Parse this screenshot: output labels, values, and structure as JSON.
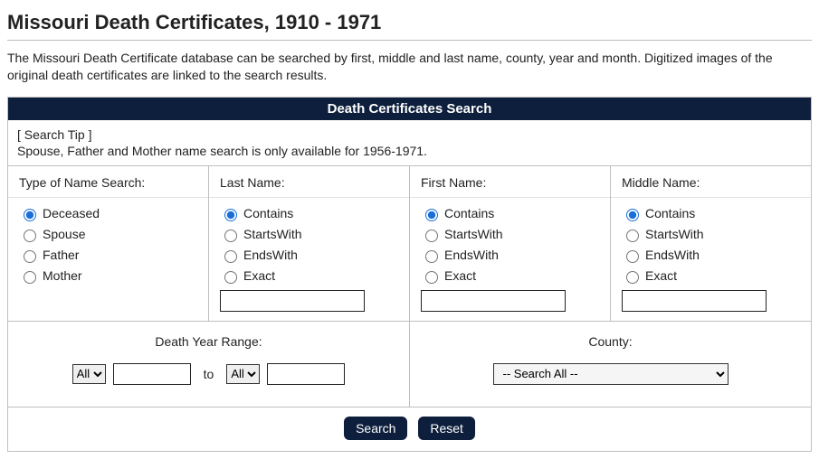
{
  "page_title": "Missouri Death Certificates, 1910 - 1971",
  "intro_text": "The Missouri Death Certificate database can be searched by first, middle and last name, county, year and month. Digitized images of the original death certificates are linked to the search results.",
  "panel_title": "Death Certificates Search",
  "tip": {
    "label": "[ Search Tip ]",
    "text": "Spouse, Father and Mother name search is only available for 1956-1971."
  },
  "type_of_name_search": {
    "heading": "Type of Name Search:",
    "options": {
      "deceased": "Deceased",
      "spouse": "Spouse",
      "father": "Father",
      "mother": "Mother"
    },
    "selected": "deceased"
  },
  "match_options": {
    "contains": "Contains",
    "startswith": "StartsWith",
    "endswith": "EndsWith",
    "exact": "Exact"
  },
  "last_name": {
    "heading": "Last Name:",
    "selected": "contains",
    "value": ""
  },
  "first_name": {
    "heading": "First Name:",
    "selected": "contains",
    "value": ""
  },
  "middle_name": {
    "heading": "Middle Name:",
    "selected": "contains",
    "value": ""
  },
  "year_range": {
    "heading": "Death Year Range:",
    "from_select": "All",
    "from_value": "",
    "to_label": "to",
    "to_select": "All",
    "to_value": ""
  },
  "county": {
    "heading": "County:",
    "selected": "-- Search All --"
  },
  "buttons": {
    "search": "Search",
    "reset": "Reset"
  }
}
